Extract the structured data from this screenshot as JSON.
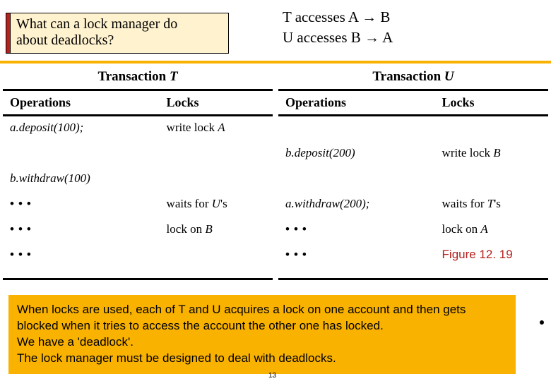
{
  "callout": {
    "line1": "What can a lock manager do",
    "line2": "about deadlocks?"
  },
  "top_right": {
    "line1_a": "T accesses A ",
    "arrow": "→",
    "line1_b": " B",
    "line2_a": "U accesses B ",
    "line2_b": " A"
  },
  "tables": {
    "t": {
      "header_a": "Transaction ",
      "header_b": "T",
      "col_ops": "Operations",
      "col_locks": "Locks",
      "rows": {
        "r1_op": "a.deposit(100);",
        "r1_lk_a": "write lock ",
        "r1_lk_b": "A",
        "r2_op": "",
        "r2_lk": "",
        "r3_op": "b.withdraw(100)",
        "r3_lk": "",
        "r4_op": "•••",
        "r4_lk_a": "waits for ",
        "r4_lk_b": "U",
        "r4_lk_c": "'s",
        "r5_op": "",
        "r5_lk_a": "lock on ",
        "r5_lk_b": "B",
        "r6_op": "•••",
        "r7_op": "•••"
      }
    },
    "u": {
      "header_a": "Transaction ",
      "header_b": "U",
      "col_ops": "Operations",
      "col_locks": "Locks",
      "rows": {
        "r1_op": "",
        "r1_lk": "",
        "r2_op": "b.deposit(200)",
        "r2_lk_a": "write lock ",
        "r2_lk_b": "B",
        "r3_op": "",
        "r3_lk": "",
        "r4_op": "a.withdraw(200);",
        "r4_lk_a": "waits for ",
        "r4_lk_b": "T",
        "r4_lk_c": "'s",
        "r5_op": "•••",
        "r5_lk_a": "lock on ",
        "r5_lk_b": "A",
        "r6_op": "•••",
        "r7_op": ""
      }
    }
  },
  "figure_label": "Figure 12. 19",
  "bottom_note": "When locks are used, each of T and U acquires a lock on one account and then gets blocked when it tries to access the account the other one has locked.\nWe have a 'deadlock'.\nThe lock manager must be designed to deal with deadlocks.",
  "page_num": "13"
}
